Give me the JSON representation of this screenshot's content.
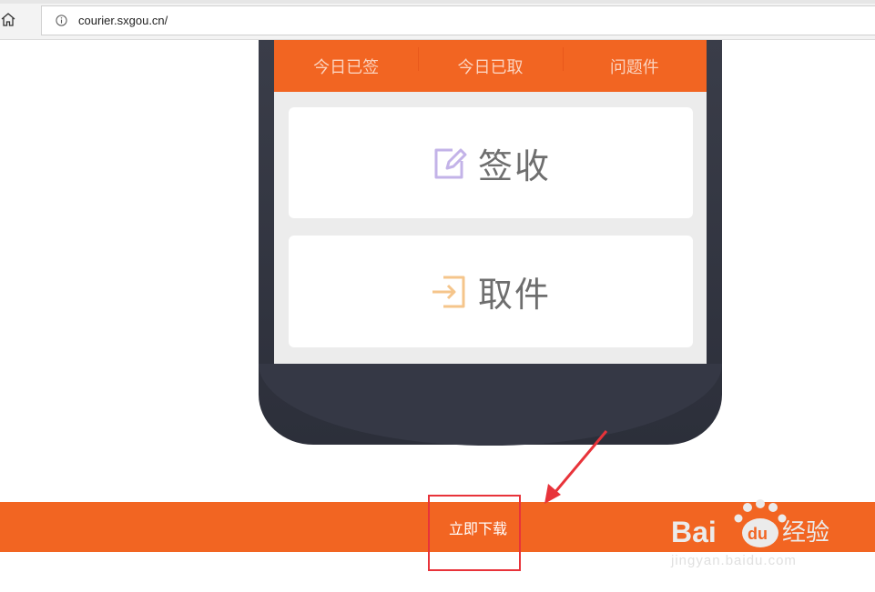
{
  "browser": {
    "url": "courier.sxgou.cn/"
  },
  "app": {
    "stats": [
      {
        "label": "今日已签"
      },
      {
        "label": "今日已取"
      },
      {
        "label": "问题件"
      }
    ],
    "actions": [
      {
        "label": "签收",
        "icon": "edit-icon",
        "icon_color": "#c3b3e8"
      },
      {
        "label": "取件",
        "icon": "login-arrow-icon",
        "icon_color": "#f5c58b"
      }
    ],
    "accent_color": "#f26522"
  },
  "download": {
    "label": "立即下载"
  },
  "watermark": {
    "brand": "Baidu经验",
    "domain": "jingyan.baidu.com"
  }
}
